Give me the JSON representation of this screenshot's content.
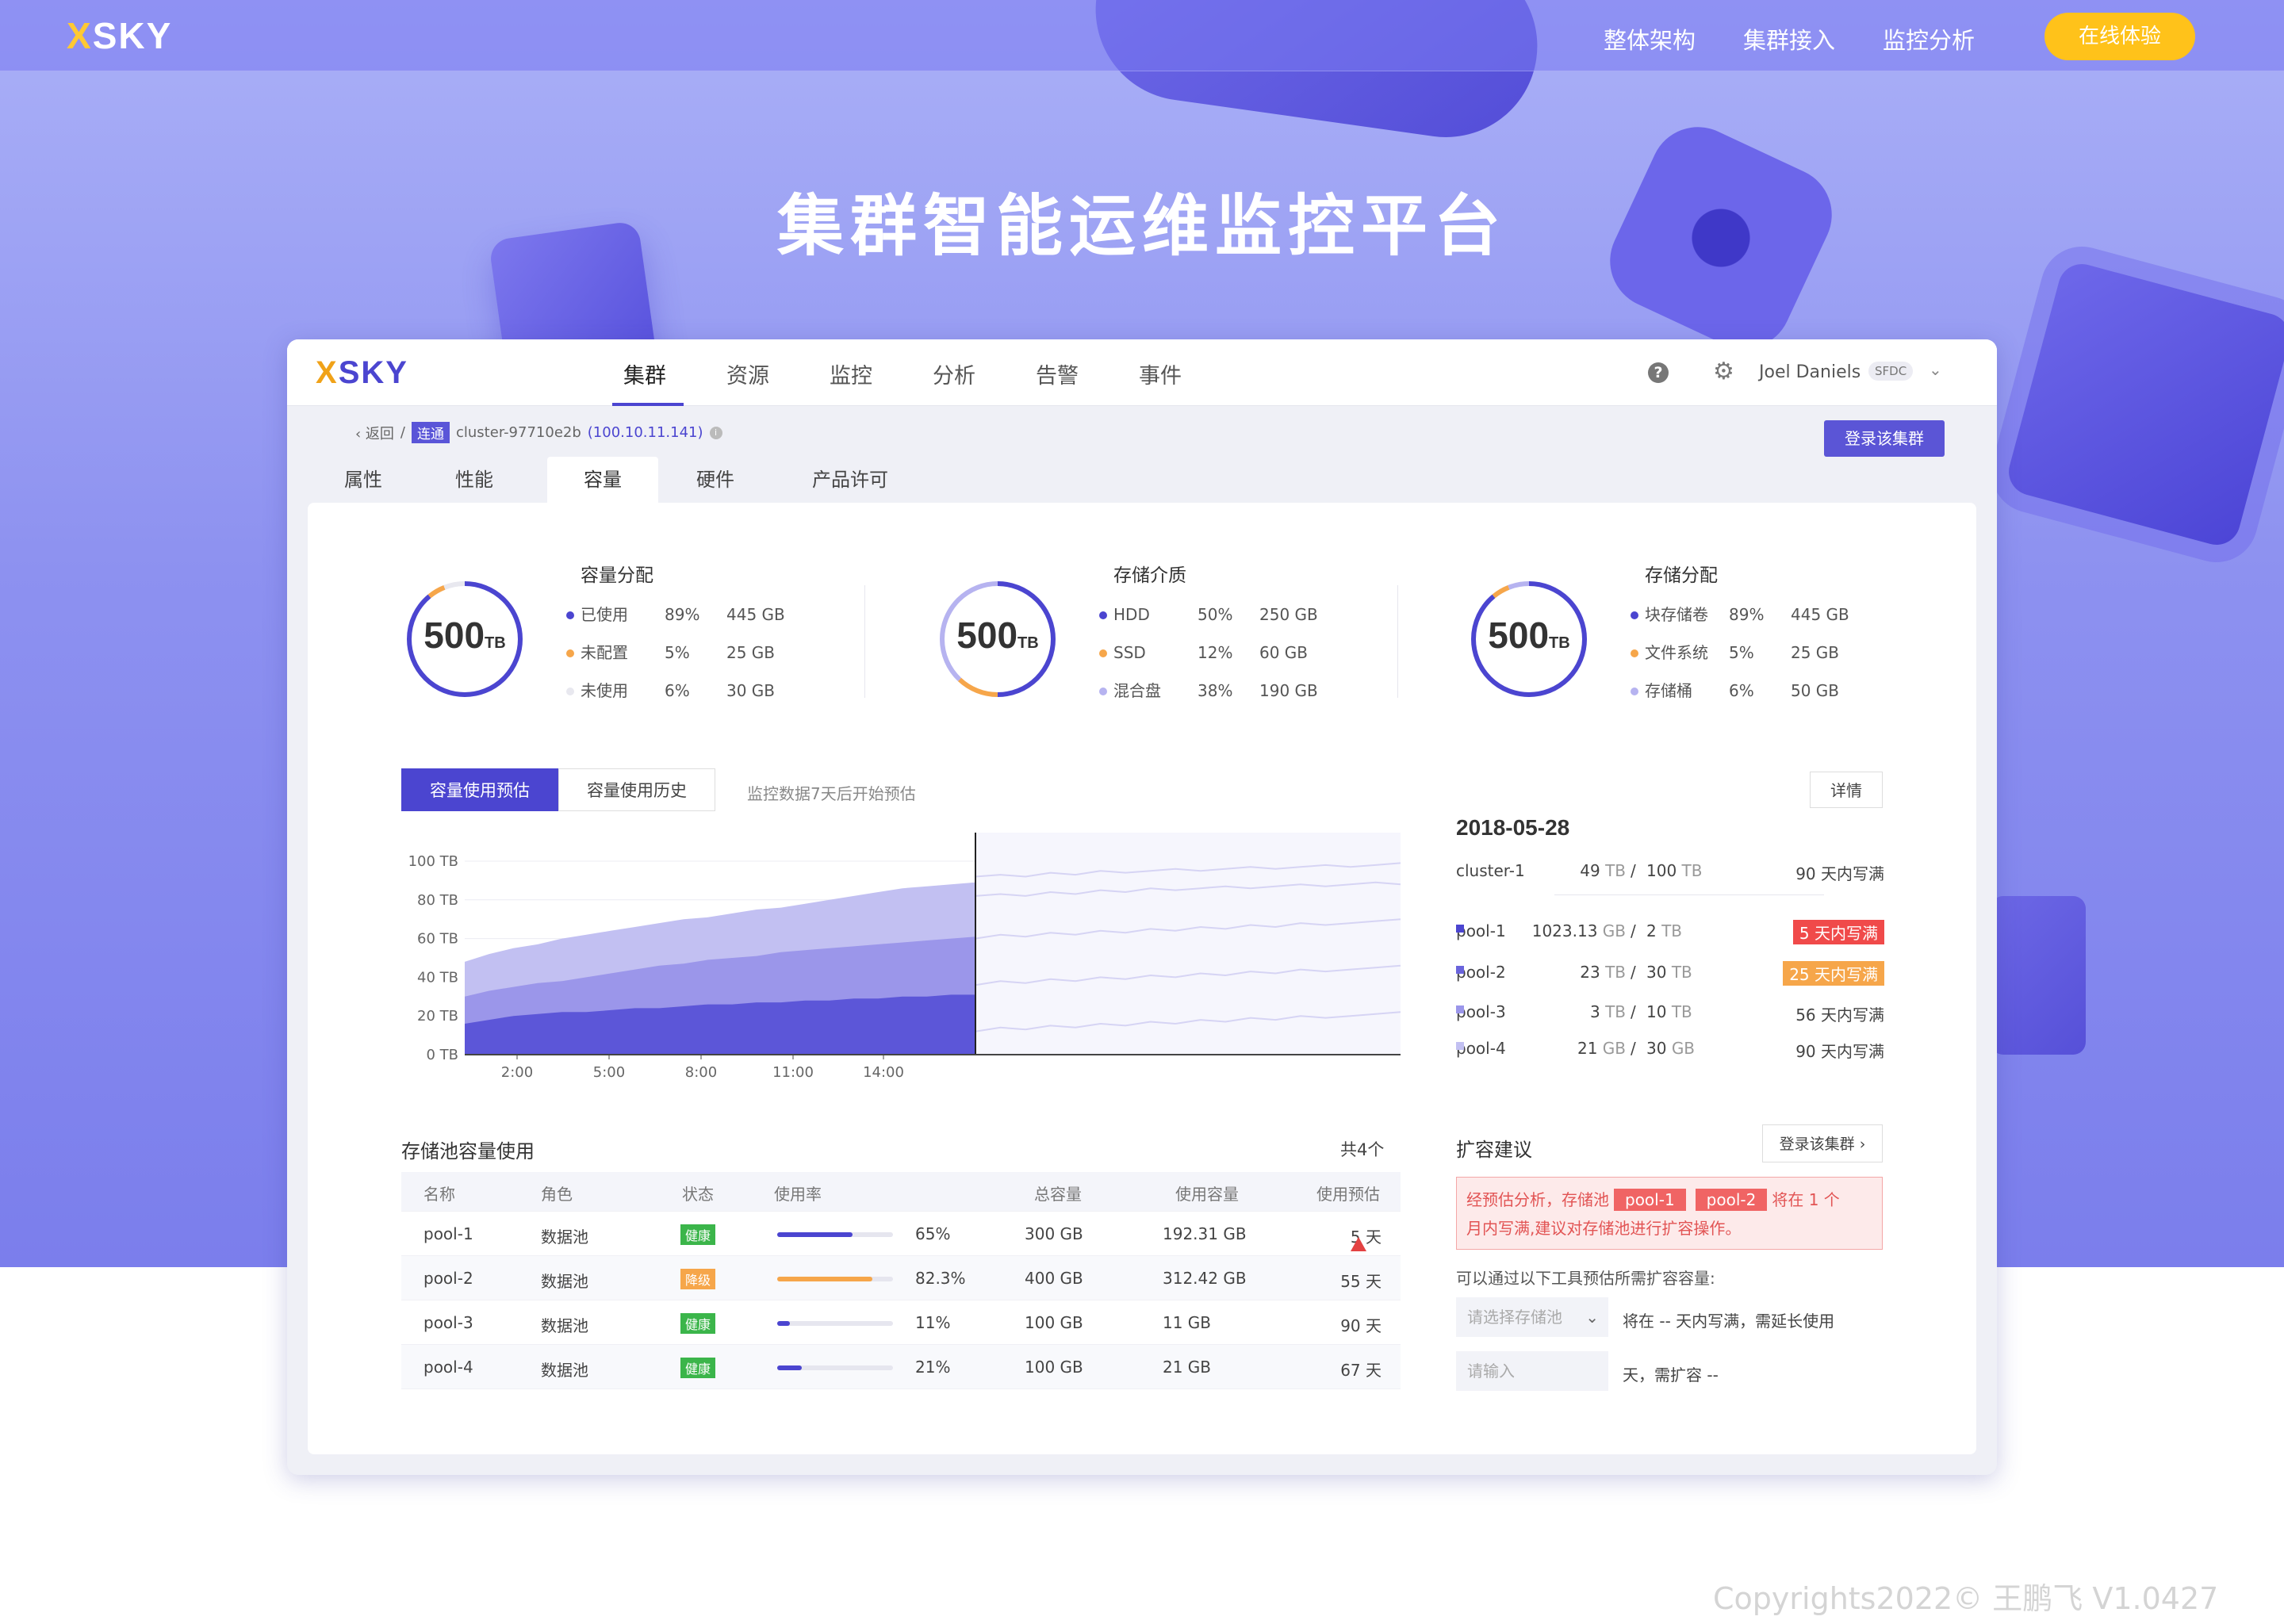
{
  "top_nav": {
    "logo": "XSKY",
    "links": [
      "整体架构",
      "集群接入",
      "监控分析"
    ],
    "cta": "在线体验"
  },
  "hero_title": "集群智能运维监控平台",
  "footer": "Copyrights2022© 王鹏飞 V1.0427",
  "colors": {
    "primary": "#4b45d0",
    "accent": "#ffc21a",
    "warning": "#f6a64a",
    "danger": "#f04a4a",
    "success": "#3bb54a"
  },
  "app": {
    "logo": "XSKY",
    "nav": [
      "集群",
      "资源",
      "监控",
      "分析",
      "告警",
      "事件"
    ],
    "active_nav": "集群",
    "user_name": "Joel Daniels",
    "user_tag": "SFDC",
    "icons": [
      "help-icon",
      "gear-icon",
      "chevron-down-icon"
    ]
  },
  "breadcrumb": {
    "back": "返回",
    "sep": "/",
    "tag": "连通",
    "cluster": "cluster-97710e2b",
    "ip": "(100.10.11.141)"
  },
  "login_button": "登录该集群",
  "subtabs": [
    "属性",
    "性能",
    "容量",
    "硬件",
    "产品许可"
  ],
  "active_subtab": "容量",
  "summary": [
    {
      "title": "容量分配",
      "total": "500",
      "unit": "TB",
      "items": [
        {
          "label": "已使用",
          "pct": "89%",
          "value": "445 GB",
          "color": "#4b45d0",
          "fraction": 0.89
        },
        {
          "label": "未配置",
          "pct": "5%",
          "value": "25 GB",
          "color": "#f6a64a",
          "fraction": 0.05
        },
        {
          "label": "未使用",
          "pct": "6%",
          "value": "30 GB",
          "color": "#e8e8ef",
          "fraction": 0.06
        }
      ]
    },
    {
      "title": "存储介质",
      "total": "500",
      "unit": "TB",
      "items": [
        {
          "label": "HDD",
          "pct": "50%",
          "value": "250 GB",
          "color": "#4b45d0",
          "fraction": 0.5
        },
        {
          "label": "SSD",
          "pct": "12%",
          "value": "60 GB",
          "color": "#f6a64a",
          "fraction": 0.12
        },
        {
          "label": "混合盘",
          "pct": "38%",
          "value": "190 GB",
          "color": "#b6b3f0",
          "fraction": 0.38
        }
      ]
    },
    {
      "title": "存储分配",
      "total": "500",
      "unit": "TB",
      "items": [
        {
          "label": "块存储卷",
          "pct": "89%",
          "value": "445 GB",
          "color": "#4b45d0",
          "fraction": 0.89
        },
        {
          "label": "文件系统",
          "pct": "5%",
          "value": "25 GB",
          "color": "#f6a64a",
          "fraction": 0.05
        },
        {
          "label": "存储桶",
          "pct": "6%",
          "value": "50 GB",
          "color": "#b6b3f0",
          "fraction": 0.06
        }
      ]
    }
  ],
  "chart_tabs": [
    "容量使用预估",
    "容量使用历史"
  ],
  "active_chart_tab": "容量使用预估",
  "chart_note": "监控数据7天后开始预估",
  "detail_button": "详情",
  "chart_data": {
    "type": "area",
    "y_ticks": [
      "0 TB",
      "20 TB",
      "40 TB",
      "60 TB",
      "80 TB",
      "100 TB"
    ],
    "ylim": [
      0,
      100
    ],
    "x_ticks": [
      "2:00",
      "5:00",
      "8:00",
      "11:00",
      "14:00"
    ],
    "forecast_split": "after 14:00",
    "series": [
      {
        "values": [
          48,
          52,
          55,
          57,
          60,
          62,
          64,
          66,
          68,
          70,
          71,
          73,
          75,
          76,
          78,
          80,
          82,
          84,
          86,
          87,
          88,
          89
        ],
        "color": "#c2c0f2"
      },
      {
        "values": [
          30,
          33,
          35,
          37,
          38,
          40,
          42,
          44,
          46,
          47,
          49,
          50,
          51,
          53,
          54,
          55,
          56,
          57,
          58,
          59,
          60,
          61
        ],
        "color": "#9b96ea"
      },
      {
        "values": [
          16,
          18,
          20,
          21,
          22,
          22,
          23,
          24,
          24,
          25,
          26,
          26,
          27,
          27,
          28,
          28,
          29,
          29,
          30,
          30,
          31,
          31
        ],
        "color": "#5c56d8"
      }
    ],
    "forecast_lines": [
      {
        "values": [
          92,
          93,
          92,
          94,
          93,
          95,
          94,
          95,
          96,
          95,
          96,
          97,
          96,
          97,
          98,
          97,
          98,
          99
        ]
      },
      {
        "values": [
          82,
          83,
          82,
          84,
          83,
          85,
          84,
          86,
          85,
          86,
          87,
          86,
          87,
          88,
          87,
          88,
          89,
          88
        ]
      },
      {
        "values": [
          60,
          62,
          61,
          63,
          62,
          64,
          63,
          65,
          64,
          66,
          65,
          67,
          66,
          68,
          67,
          68,
          69,
          70
        ]
      },
      {
        "values": [
          36,
          38,
          37,
          39,
          38,
          40,
          39,
          41,
          40,
          42,
          41,
          43,
          42,
          44,
          43,
          44,
          45,
          46
        ]
      },
      {
        "values": [
          12,
          14,
          13,
          15,
          14,
          16,
          15,
          17,
          16,
          18,
          17,
          19,
          18,
          20,
          19,
          20,
          21,
          22
        ]
      }
    ]
  },
  "forecast": {
    "date": "2018-05-28",
    "cluster": {
      "name": "cluster-1",
      "used": "49",
      "used_unit": "TB",
      "total": "100",
      "total_unit": "TB",
      "days": "90 天内写满"
    },
    "pools": [
      {
        "name": "pool-1",
        "used": "1023.13",
        "used_unit": "GB",
        "total": "2",
        "total_unit": "TB",
        "days": "5 天内写满",
        "level": "red",
        "color": "#4b45d0"
      },
      {
        "name": "pool-2",
        "used": "23",
        "used_unit": "TB",
        "total": "30",
        "total_unit": "TB",
        "days": "25 天内写满",
        "level": "orange",
        "color": "#6a64dc"
      },
      {
        "name": "pool-3",
        "used": "3",
        "used_unit": "TB",
        "total": "10",
        "total_unit": "TB",
        "days": "56 天内写满",
        "level": "none",
        "color": "#9b96ea"
      },
      {
        "name": "pool-4",
        "used": "21",
        "used_unit": "GB",
        "total": "30",
        "total_unit": "GB",
        "days": "90 天内写满",
        "level": "none",
        "color": "#c2c0f2"
      }
    ]
  },
  "pool_table": {
    "title": "存储池容量使用",
    "count": "共4个",
    "headers": [
      "名称",
      "角色",
      "状态",
      "使用率",
      "总容量",
      "使用容量",
      "使用预估"
    ],
    "rows": [
      {
        "name": "pool-1",
        "role": "数据池",
        "status": "健康",
        "status_color": "#3bb54a",
        "usage": "65%",
        "usage_fraction": 0.65,
        "bar_color": "#4b45d0",
        "total": "300 GB",
        "used": "192.31 GB",
        "estimate": "5 天",
        "warn": true
      },
      {
        "name": "pool-2",
        "role": "数据池",
        "status": "降级",
        "status_color": "#f6a64a",
        "usage": "82.3%",
        "usage_fraction": 0.823,
        "bar_color": "#f6a64a",
        "total": "400 GB",
        "used": "312.42 GB",
        "estimate": "55 天",
        "warn": false
      },
      {
        "name": "pool-3",
        "role": "数据池",
        "status": "健康",
        "status_color": "#3bb54a",
        "usage": "11%",
        "usage_fraction": 0.11,
        "bar_color": "#4b45d0",
        "total": "100 GB",
        "used": "11 GB",
        "estimate": "90 天",
        "warn": false
      },
      {
        "name": "pool-4",
        "role": "数据池",
        "status": "健康",
        "status_color": "#3bb54a",
        "usage": "21%",
        "usage_fraction": 0.21,
        "bar_color": "#4b45d0",
        "total": "100 GB",
        "used": "21 GB",
        "estimate": "67 天",
        "warn": false
      }
    ]
  },
  "suggestion": {
    "title": "扩容建议",
    "button": "登录该集群",
    "alert_prefix": "经预估分析，存储池",
    "alert_pools": [
      "pool-1",
      "pool-2"
    ],
    "alert_suffix": "将在 1 个",
    "alert_line2": "月内写满,建议对存储池进行扩容操作。",
    "hint": "可以通过以下工具预估所需扩容容量:",
    "select_placeholder": "请选择存储池",
    "line1": "将在 -- 天内写满，需延长使用",
    "input_placeholder": "请输入",
    "line2": "天，需扩容 --"
  }
}
